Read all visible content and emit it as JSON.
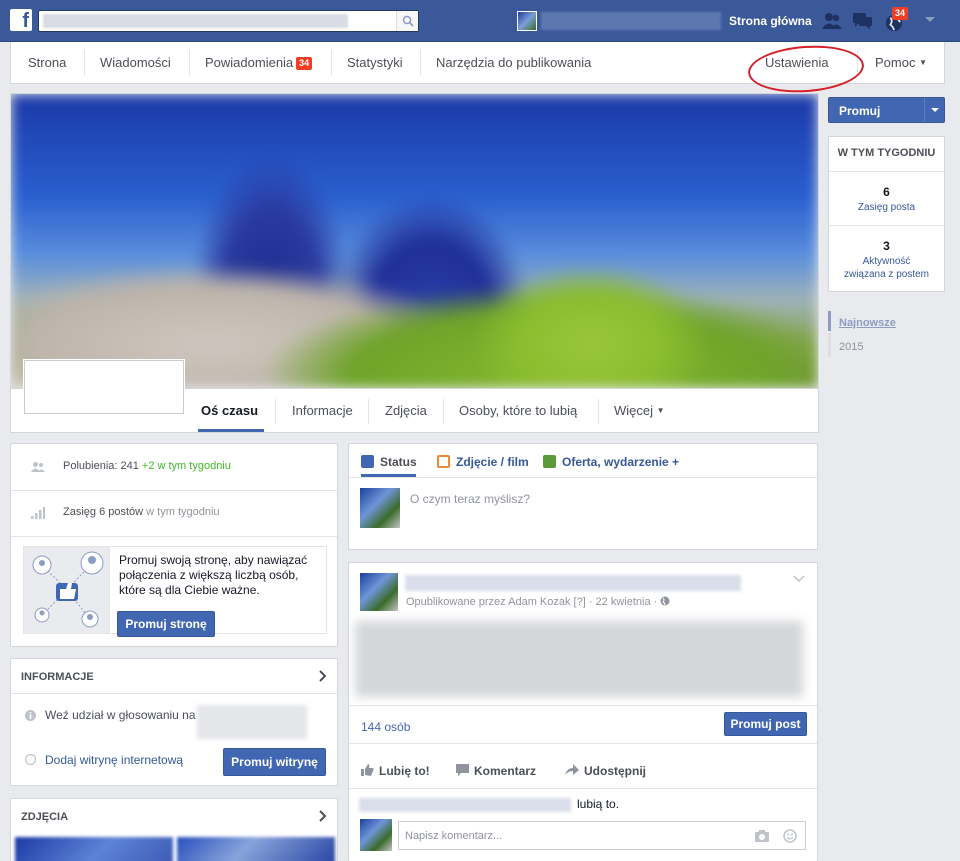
{
  "topbar": {
    "logo": "f",
    "home_label": "Strona główna",
    "notifications_badge": "34",
    "icons": [
      "search-icon",
      "friends-icon",
      "messages-icon",
      "globe-icon",
      "chevron-down-icon"
    ]
  },
  "page_nav": {
    "items": [
      "Strona",
      "Wiadomości",
      "Powiadomienia",
      "Statystyki",
      "Narzędzia do publikowania",
      "Ustawienia",
      "Pomoc"
    ],
    "notifications_badge": "34"
  },
  "cover_tabs": [
    "Oś czasu",
    "Informacje",
    "Zdjęcia",
    "Osoby, które to lubią",
    "Więcej"
  ],
  "right": {
    "promote_label": "Promuj",
    "week_title": "W TYM TYGODNIU",
    "reach_num": "6",
    "reach_label": "Zasięg posta",
    "engagement_num": "3",
    "engagement_label_1": "Aktywność",
    "engagement_label_2": "związana z postem",
    "timeline_newest": "Najnowsze",
    "timeline_year": "2015"
  },
  "left": {
    "likes_label": "Polubienia: 241",
    "likes_delta": "+2 w tym tygodniu",
    "reach_label": "Zasięg 6 postów",
    "reach_suffix": "w tym tygodniu",
    "promo_text": "Promuj swoją stronę, aby nawiązać połączenia z większą liczbą osób, które są dla Ciebie ważne.",
    "promo_button": "Promuj stronę",
    "info_title": "INFORMACJE",
    "vote_label": "Weź udział w głosowaniu na",
    "website_label": "Dodaj witrynę internetową",
    "website_button": "Promuj witrynę",
    "photos_title": "ZDJĘCIA"
  },
  "composer": {
    "tab_status": "Status",
    "tab_photo": "Zdjęcie / film",
    "tab_offer": "Oferta, wydarzenie +",
    "placeholder": "O czym teraz myślisz?"
  },
  "post": {
    "meta": "Opublikowane przez Adam Kozak [?] · 22 kwietnia ·",
    "reach": "144 osób",
    "promote_button": "Promuj post",
    "like": "Lubię to!",
    "comment": "Komentarz",
    "share": "Udostępnij",
    "likes_suffix": "lubią to.",
    "comment_placeholder": "Napisz komentarz..."
  }
}
